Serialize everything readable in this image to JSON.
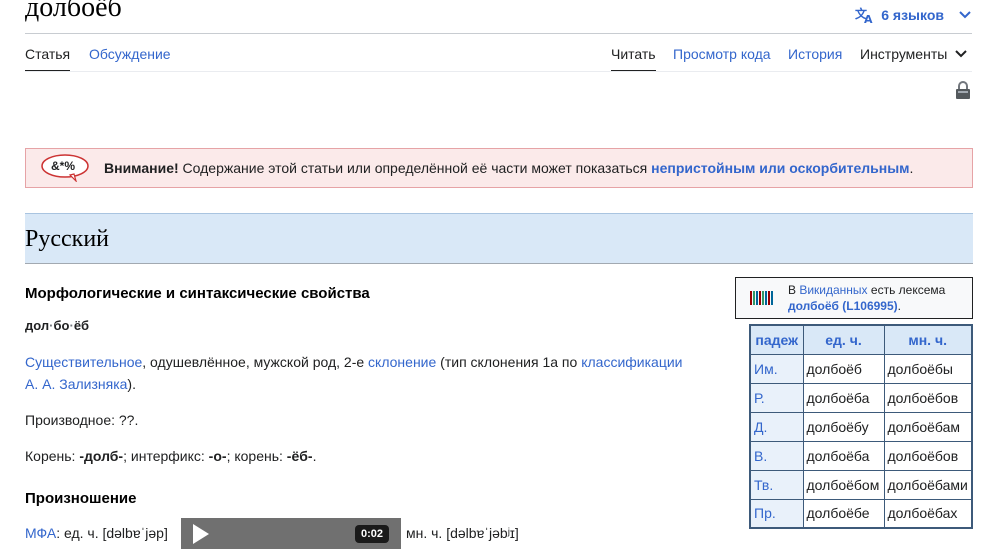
{
  "page": {
    "title": "долбоёб",
    "languages_label": "6 языков"
  },
  "tabs": {
    "article": "Статья",
    "talk": "Обсуждение",
    "read": "Читать",
    "view_source": "Просмотр кода",
    "history": "История",
    "tools": "Инструменты"
  },
  "warning": {
    "icon_text": "&*%",
    "bold_prefix": "Внимание!",
    "text": " Содержание этой статьи или определённой её части может показаться ",
    "link": "непристойным или оскорбительным",
    "suffix": "."
  },
  "section": {
    "language": "Русский"
  },
  "morph": {
    "heading": "Морфологические и синтаксические свойства",
    "syllables": [
      "дол",
      "бо",
      "ёб"
    ],
    "syl_sep": "·",
    "pos_link": "Существительное",
    "pos_text": ", одушевлённое, мужской род, 2-е ",
    "declension_link": "склонение",
    "type_text": " (тип склонения 1a по ",
    "classification_link": "классификации",
    "zaliznyak_link": "А. А. Зализняка",
    "close_text": ").",
    "derivative": "Производное: ??.",
    "root_label": "Корень: ",
    "root1": "-долб-",
    "interfix_label": "; интерфикс: ",
    "interfix": "-о-",
    "root2_label": "; корень: ",
    "root2": "-ёб-",
    "end": "."
  },
  "wikidata": {
    "prefix": "В ",
    "link": "Викиданных",
    "middle": " есть лексема",
    "lexeme_link": "долбоёб (L106995)",
    "end": "."
  },
  "inflection": {
    "headers": [
      "падеж",
      "ед. ч.",
      "мн. ч."
    ],
    "rows": [
      [
        "Им.",
        "долбоёб",
        "долбоёбы"
      ],
      [
        "Р.",
        "долбоёба",
        "долбоёбов"
      ],
      [
        "Д.",
        "долбоёбу",
        "долбоёбам"
      ],
      [
        "В.",
        "долбоёба",
        "долбоёбов"
      ],
      [
        "Тв.",
        "долбоёбом",
        "долбоёбами"
      ],
      [
        "Пр.",
        "долбоёбе",
        "долбоёбах"
      ]
    ]
  },
  "pronunciation": {
    "heading": "Произношение",
    "ipa_link": "МФА",
    "sg_text": ": ед. ч. [dəlbɐˈjəp]",
    "audio_duration": "0:02",
    "pl_text": "мн. ч. [dəlbɐˈjəbʲɪ]"
  },
  "colors": {
    "link": "#3366cc",
    "section_bg": "#d9e8f7",
    "warning_bg": "#fbeaea",
    "warning_border": "#e6a3a6"
  }
}
